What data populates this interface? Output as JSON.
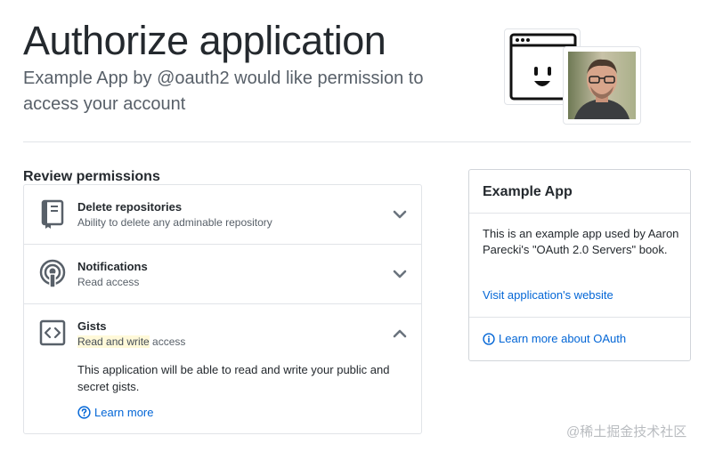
{
  "header": {
    "title": "Authorize application",
    "app_name": "Example App",
    "by_text": "by",
    "owner": "@oauth2",
    "request_text": "would like permission to access your account"
  },
  "review": {
    "heading": "Review permissions",
    "permissions": [
      {
        "title": "Delete repositories",
        "description": "Ability to delete any adminable repository",
        "icon": "repo-icon",
        "expanded": false
      },
      {
        "title": "Notifications",
        "description": "Read access",
        "icon": "broadcast-icon",
        "expanded": false
      },
      {
        "title": "Gists",
        "description_highlight": "Read and write",
        "description_rest": " access",
        "icon": "code-icon",
        "expanded": true,
        "detail": "This application will be able to read and write your public and secret gists.",
        "learn_more": "Learn more"
      }
    ]
  },
  "app_card": {
    "title": "Example App",
    "description": "This is an example app used by Aaron Parecki's \"OAuth 2.0 Servers\" book.",
    "website_link": "Visit application's website",
    "oauth_link": "Learn more about OAuth"
  },
  "watermark": "@稀土掘金技术社区",
  "colors": {
    "link": "#0366d6",
    "text": "#24292e",
    "muted": "#586069",
    "border": "#e1e4e8",
    "highlight": "#fff9d9"
  }
}
